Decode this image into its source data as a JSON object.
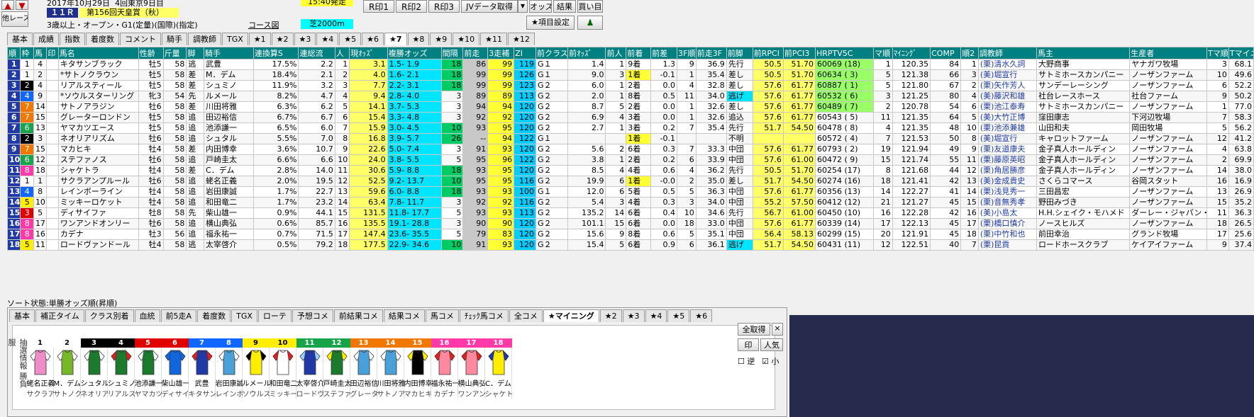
{
  "header": {
    "date": "2017年10月29日",
    "meeting": "4回東京9日目",
    "race_no": "１１Ｒ",
    "race_name": "第156回天皇賞（秋）",
    "race_conditions": "3歳以上・オープン・G1(定量)(国際)(指定)",
    "start_time": "15:40発走",
    "course_label": "コース図",
    "course_value": "芝2000m",
    "other_race": "他レース",
    "buttons": [
      "R印1",
      "R印2",
      "R印3",
      "JVデータ取得",
      "オッズ",
      "結果",
      "買い目"
    ],
    "item_setting": "★項目設定"
  },
  "tabs": [
    "基本",
    "成績",
    "指数",
    "着度数",
    "コメント",
    "騎手",
    "調教師",
    "TGX",
    "★1",
    "★2",
    "★3",
    "★4",
    "★5",
    "★6",
    "★7",
    "★8",
    "★9",
    "★10",
    "★11",
    "★12"
  ],
  "active_tab": "★7",
  "columns": [
    "順",
    "枠",
    "馬",
    "印",
    "馬名",
    "性齢",
    "斤量",
    "脚",
    "騎手",
    "連換算S",
    "連総流",
    "人",
    "現ｵｯｽﾞ",
    "複勝オッズ",
    "間隔",
    "前走",
    "3走補",
    "ZI",
    "前クラス",
    "前ｵｯｽﾞ",
    "前人",
    "前着",
    "前差",
    "3F順",
    "前走3F",
    "前脚",
    "前RPCI",
    "前PCI3",
    "HRPTV5C",
    "マ順",
    "ﾏｲﾆﾝｸﾞ",
    "COMP",
    "順2",
    "調教師",
    "馬主",
    "生産者",
    "Tマ順",
    "Tマイニン"
  ],
  "rows": [
    [
      "1",
      "1",
      "4",
      "",
      "キタサンブラック",
      "牡5",
      "58",
      "逃",
      "武豊",
      "17.5%",
      "2.2",
      "1",
      "3.1",
      "1.5- 1.9",
      "18",
      "86",
      "99",
      "119",
      "G１",
      "1.4",
      "1",
      "9着",
      "1.3",
      "9",
      "36.9",
      "先行",
      "50.5",
      "51.70",
      "60069 (18)",
      "1",
      "120.35",
      "84",
      "1",
      "(栗)清水久詞",
      "大野商事",
      "ヤナガワ牧場",
      "3",
      "68.1"
    ],
    [
      "2",
      "1",
      "2",
      "",
      "*サトノクラウン",
      "牡5",
      "58",
      "差",
      "M．デム",
      "18.4%",
      "2.1",
      "2",
      "4.0",
      "1.6- 2.1",
      "18",
      "99",
      "99",
      "126",
      "G１",
      "9.0",
      "3",
      "1着",
      "-0.1",
      "1",
      "35.4",
      "差し",
      "50.5",
      "51.70",
      "60634 ( 3)",
      "5",
      "121.38",
      "66",
      "3",
      "(美)堀宣行",
      "サトミホースカンパニー",
      "ノーザンファーム",
      "10",
      "49.6"
    ],
    [
      "3",
      "2",
      "4",
      "",
      "リアルスティール",
      "牡5",
      "58",
      "差",
      "シュミノ",
      "11.9%",
      "3.2",
      "3",
      "7.7",
      "2.2- 3.1",
      "18",
      "99",
      "99",
      "123",
      "G２",
      "6.0",
      "1",
      "2着",
      "0.0",
      "4",
      "32.8",
      "差し",
      "57.6",
      "61.77",
      "60887 ( 1)",
      "5",
      "121.80",
      "67",
      "2",
      "(栗)矢作芳人",
      "サンデーレーシング",
      "ノーザンファーム",
      "6",
      "52.2"
    ],
    [
      "4",
      "4",
      "9",
      "",
      "*ソウルスターリング",
      "牝3",
      "54",
      "先",
      "ルメール",
      "8.2%",
      "4.7",
      "4",
      "9.4",
      "2.8- 4.0",
      "3",
      "89",
      "89",
      "113",
      "G２",
      "2.0",
      "1",
      "8着",
      "0.5",
      "11",
      "34.0",
      "逃げ",
      "57.6",
      "61.77",
      "60532 ( 6)",
      "3",
      "121.25",
      "80",
      "4",
      "(美)藤沢和雄",
      "社台レースホース",
      "社台ファーム",
      "9",
      "50.2"
    ],
    [
      "5",
      "7",
      "14",
      "",
      "サトノアラジン",
      "牡6",
      "58",
      "差",
      "川田将雅",
      "6.3%",
      "6.2",
      "5",
      "14.1",
      "3.7- 5.3",
      "3",
      "94",
      "94",
      "120",
      "G２",
      "8.7",
      "5",
      "2着",
      "0.0",
      "1",
      "32.6",
      "差し",
      "57.6",
      "61.77",
      "60489 ( 7)",
      "2",
      "120.78",
      "54",
      "6",
      "(栗)池江泰寿",
      "サトミホースカンパニー",
      "ノーザンファーム",
      "1",
      "77.0"
    ],
    [
      "6",
      "7",
      "15",
      "",
      "グレーターロンドン",
      "牡5",
      "58",
      "追",
      "田辺裕信",
      "6.7%",
      "6.7",
      "6",
      "15.4",
      "3.3- 4.8",
      "3",
      "92",
      "92",
      "120",
      "G２",
      "6.9",
      "4",
      "3着",
      "0.0",
      "1",
      "32.6",
      "追込",
      "57.6",
      "61.77",
      "60543 ( 5)",
      "11",
      "121.35",
      "64",
      "5",
      "(美)大竹正博",
      "窪田康志",
      "下河辺牧場",
      "7",
      "58.3"
    ],
    [
      "7",
      "6",
      "13",
      "",
      "ヤマカツエース",
      "牡5",
      "58",
      "追",
      "池添謙一",
      "6.5%",
      "6.0",
      "7",
      "15.9",
      "3.0- 4.5",
      "10",
      "93",
      "95",
      "120",
      "G２",
      "2.7",
      "1",
      "3着",
      "0.2",
      "7",
      "35.4",
      "先行",
      "51.7",
      "54.50",
      "60478 ( 8)",
      "4",
      "121.35",
      "48",
      "10",
      "(栗)池添兼雄",
      "山田和夫",
      "岡田牧場",
      "5",
      "56.2"
    ],
    [
      "8",
      "2",
      "3",
      "",
      "ネオリアリズム",
      "牡6",
      "58",
      "追",
      "シュタル",
      "5.5%",
      "7.0",
      "8",
      "16.8",
      "3.9- 5.7",
      "26",
      "--",
      "94",
      "122",
      "G１",
      "",
      "",
      "1着",
      "-0.1",
      "",
      "",
      "不明",
      "",
      "",
      "60572 ( 4)",
      "7",
      "121.53",
      "50",
      "8",
      "(美)堀宣行",
      "キャロットファーム",
      "ノーザンファーム",
      "12",
      "41.2"
    ],
    [
      "9",
      "7",
      "15",
      "",
      "マカヒキ",
      "牡4",
      "58",
      "差",
      "内田博幸",
      "3.6%",
      "10.7",
      "9",
      "22.6",
      "5.0- 7.4",
      "3",
      "91",
      "93",
      "120",
      "G２",
      "5.6",
      "2",
      "6着",
      "0.3",
      "7",
      "33.3",
      "中団",
      "57.6",
      "61.77",
      "60793 ( 2)",
      "19",
      "121.94",
      "49",
      "9",
      "(栗)友道康夫",
      "金子真人ホールディン",
      "ノーザンファーム",
      "4",
      "63.8"
    ],
    [
      "10",
      "6",
      "12",
      "",
      "ステファノス",
      "牡6",
      "58",
      "追",
      "戸崎圭太",
      "6.6%",
      "6.6",
      "10",
      "24.0",
      "3.8- 5.5",
      "5",
      "95",
      "96",
      "122",
      "G２",
      "3.8",
      "1",
      "2着",
      "0.2",
      "6",
      "33.9",
      "中団",
      "57.6",
      "61.00",
      "60472 ( 9)",
      "15",
      "121.74",
      "55",
      "11",
      "(栗)藤原英昭",
      "金子真人ホールディン",
      "ノーザンファーム",
      "2",
      "69.9"
    ],
    [
      "11",
      "8",
      "18",
      "",
      "シャケトラ",
      "牡4",
      "58",
      "差",
      "C．デム",
      "2.8%",
      "14.0",
      "11",
      "30.6",
      "5.9- 8.8",
      "18",
      "93",
      "95",
      "120",
      "G２",
      "8.5",
      "4",
      "4着",
      "0.6",
      "4",
      "36.2",
      "先行",
      "50.5",
      "51.70",
      "60254 (17)",
      "8",
      "121.68",
      "44",
      "12",
      "(栗)角居勝彦",
      "金子真人ホールディン",
      "ノーザンファーム",
      "14",
      "38.0"
    ],
    [
      "12",
      "1",
      "1",
      "",
      "サクラアンプルール",
      "牡6",
      "58",
      "追",
      "蛯名正義",
      "2.0%",
      "19.5",
      "12",
      "52.5",
      "9.2- 13.7",
      "10",
      "95",
      "95",
      "116",
      "G２",
      "19.9",
      "6",
      "1着",
      "-0.0",
      "2",
      "35.0",
      "差し",
      "51.7",
      "54.50",
      "60274 (16)",
      "18",
      "121.41",
      "42",
      "13",
      "(美)金成貴史",
      "さくらコマース",
      "谷岡スタット",
      "16",
      "16.9"
    ],
    [
      "13",
      "4",
      "8",
      "",
      "レインボーライン",
      "牡4",
      "58",
      "追",
      "岩田康誠",
      "1.7%",
      "22.7",
      "13",
      "59.6",
      "6.0- 8.8",
      "18",
      "93",
      "93",
      "100",
      "G１",
      "12.0",
      "6",
      "5着",
      "0.5",
      "5",
      "36.3",
      "中団",
      "57.6",
      "61.77",
      "60356 (13)",
      "14",
      "122.27",
      "41",
      "14",
      "(栗)浅見秀一",
      "三田昌宏",
      "ノーザンファーム",
      "13",
      "26.9"
    ],
    [
      "14",
      "5",
      "10",
      "",
      "ミッキーロケット",
      "牡4",
      "58",
      "追",
      "和田竜二",
      "1.7%",
      "23.2",
      "14",
      "63.4",
      "7.8- 11.7",
      "3",
      "92",
      "92",
      "116",
      "G２",
      "5.4",
      "3",
      "4着",
      "0.3",
      "3",
      "34.0",
      "中団",
      "55.2",
      "57.50",
      "60412 (12)",
      "21",
      "121.27",
      "45",
      "15",
      "(栗)音無秀孝",
      "野田みづき",
      "ノーザンファーム",
      "15",
      "35.2"
    ],
    [
      "15",
      "3",
      "5",
      "",
      "ディサイファ",
      "牡8",
      "58",
      "先",
      "柴山雄一",
      "0.9%",
      "44.1",
      "15",
      "131.5",
      "11.8- 17.7",
      "5",
      "93",
      "93",
      "113",
      "G２",
      "135.2",
      "14",
      "6着",
      "0.4",
      "10",
      "34.6",
      "先行",
      "56.7",
      "61.00",
      "60450 (10)",
      "16",
      "122.28",
      "42",
      "16",
      "(美)小島太",
      "H.H.シェイク・モハメド",
      "ダーレー・ジャパン・フ",
      "11",
      "36.3"
    ],
    [
      "16",
      "8",
      "17",
      "",
      "ワンアンドオンリー",
      "牡6",
      "58",
      "追",
      "横山典弘",
      "0.6%",
      "85.7",
      "16",
      "135.5",
      "19.1- 28.8",
      "3",
      "90",
      "90",
      "120",
      "G２",
      "101.1",
      "15",
      "6着",
      "0.0",
      "18",
      "33.0",
      "中団",
      "57.6",
      "61.77",
      "60339 (14)",
      "17",
      "122.13",
      "45",
      "17",
      "(栗)橋口慎介",
      "ノースヒルズ",
      "ノーザンファーム",
      "18",
      "26.5"
    ],
    [
      "17",
      "8",
      "16",
      "",
      "カデナ",
      "牡3",
      "56",
      "追",
      "福永祐一",
      "0.7%",
      "71.5",
      "17",
      "147.4",
      "23.6- 35.5",
      "5",
      "79",
      "83",
      "120",
      "G２",
      "15.6",
      "9",
      "8着",
      "0.6",
      "5",
      "35.1",
      "中団",
      "56.4",
      "58.13",
      "60299 (15)",
      "20",
      "121.91",
      "45",
      "18",
      "(栗)中竹和也",
      "前田幸治",
      "グランド牧場",
      "17",
      "25.6"
    ],
    [
      "18",
      "5",
      "11",
      "",
      "ロードヴァンドール",
      "牡4",
      "58",
      "逃",
      "太宰啓介",
      "0.5%",
      "79.2",
      "18",
      "177.5",
      "22.9- 34.6",
      "10",
      "91",
      "93",
      "120",
      "G２",
      "15.4",
      "5",
      "6着",
      "0.9",
      "6",
      "36.1",
      "逃げ",
      "51.7",
      "54.50",
      "60431 (11)",
      "12",
      "122.51",
      "40",
      "7",
      "(栗)昆貢",
      "ロードホースクラブ",
      "ケイアイファーム",
      "9",
      "37.4"
    ]
  ],
  "sort_status": "ソート状態:単勝オッズ順(昇順)",
  "bottom_tabs": [
    "基本",
    "補正タイム",
    "クラス別着",
    "血統",
    "前5走A",
    "着度数",
    "TGX",
    "ローテ",
    "予想コメ",
    "前結果コメ",
    "結果コメ",
    "馬コメ",
    "ﾁｪｯｸ馬コメ",
    "全コメ",
    "★マイニング",
    "★2",
    "★3",
    "★4",
    "★5",
    "★6"
  ],
  "bottom_active_tab": "★マイニング",
  "side_label": "抽選情報 勝負服",
  "silks": [
    {
      "num": "1",
      "head": "#ffffff",
      "fg": "#000",
      "jockey": "蛯名正義",
      "horse": "サクラアンプ",
      "body": "#f08cc8",
      "sleeve": "#ffffff"
    },
    {
      "num": "2",
      "head": "#ffffff",
      "fg": "#000",
      "jockey": "M．デム",
      "horse": "サトノクラウ",
      "body": "#76b82a",
      "sleeve": "#ffffff"
    },
    {
      "num": "3",
      "head": "#000000",
      "fg": "#fff",
      "jockey": "シュタル",
      "horse": "ネオリアリズ",
      "body": "#1c7a2c",
      "sleeve": "#ffffff"
    },
    {
      "num": "4",
      "head": "#000000",
      "fg": "#fff",
      "jockey": "シュミノ",
      "horse": "リアルスティ",
      "body": "#1c7a2c",
      "sleeve": "#e02020"
    },
    {
      "num": "5",
      "head": "#e00000",
      "fg": "#fff",
      "jockey": "池添謙一",
      "horse": "ヤマカツエー",
      "body": "#1c7a2c",
      "sleeve": "#ffffff"
    },
    {
      "num": "6",
      "head": "#e00000",
      "fg": "#fff",
      "jockey": "柴山雄一",
      "horse": "ディサイファ",
      "body": "#1166dd",
      "sleeve": "#1166dd"
    },
    {
      "num": "7",
      "head": "#1166ff",
      "fg": "#fff",
      "jockey": "武豊",
      "horse": "キタサンブラ",
      "body": "#1f3aa6",
      "sleeve": "#e02020"
    },
    {
      "num": "8",
      "head": "#1166ff",
      "fg": "#fff",
      "jockey": "岩田康誠",
      "horse": "レインボーラ",
      "body": "#4aa0d8",
      "sleeve": "#ffffff"
    },
    {
      "num": "9",
      "head": "#ffee00",
      "fg": "#000",
      "jockey": "ルメール",
      "horse": "ソウルスター",
      "body": "#ffee00",
      "sleeve": "#000000"
    },
    {
      "num": "10",
      "head": "#ffee00",
      "fg": "#000",
      "jockey": "和田竜二",
      "horse": "ミッキーロケ",
      "body": "#ffffff",
      "sleeve": "#e02020"
    },
    {
      "num": "11",
      "head": "#16a34a",
      "fg": "#fff",
      "jockey": "太宰啓介",
      "horse": "ロードヴァン",
      "body": "#1f3aa6",
      "sleeve": "#9ad0ff"
    },
    {
      "num": "12",
      "head": "#16a34a",
      "fg": "#fff",
      "jockey": "戸崎圭太",
      "horse": "ステファノス",
      "body": "#1c7a2c",
      "sleeve": "#ffee00"
    },
    {
      "num": "13",
      "head": "#f07800",
      "fg": "#fff",
      "jockey": "田辺裕信",
      "horse": "グレーターロ",
      "body": "#4aa0d8",
      "sleeve": "#ffffff"
    },
    {
      "num": "14",
      "head": "#f07800",
      "fg": "#fff",
      "jockey": "川田将雅",
      "horse": "サトノアラジ",
      "body": "#4aa0d8",
      "sleeve": "#ffffff"
    },
    {
      "num": "15",
      "head": "#f07800",
      "fg": "#fff",
      "jockey": "内田博幸",
      "horse": "マカヒキ",
      "body": "#000000",
      "sleeve": "#ffee00"
    },
    {
      "num": "16",
      "head": "#ff3aa8",
      "fg": "#fff",
      "jockey": "福永祐一",
      "horse": "カデナ",
      "body": "#ff8aa0",
      "sleeve": "#e02020"
    },
    {
      "num": "17",
      "head": "#ff3aa8",
      "fg": "#fff",
      "jockey": "横山典弘",
      "horse": "ワンアンドオ",
      "body": "#ff8aa0",
      "sleeve": "#e02020"
    },
    {
      "num": "18",
      "head": "#ff3aa8",
      "fg": "#fff",
      "jockey": "C．デム",
      "horse": "シャケトラ",
      "body": "#ffee00",
      "sleeve": "#1f3aa6"
    }
  ],
  "right_panel": {
    "fetch_all": "全取得",
    "close": "×",
    "mark": "印",
    "popularity": "人気",
    "reverse": "逆",
    "small": "小"
  },
  "frame_colors": {
    "1": "#ffffff",
    "2": "#000000",
    "3": "#e00000",
    "4": "#1166ff",
    "5": "#ffee00",
    "6": "#16a34a",
    "7": "#f07800",
    "8": "#ff3aa8"
  },
  "header_accent": "#008080"
}
